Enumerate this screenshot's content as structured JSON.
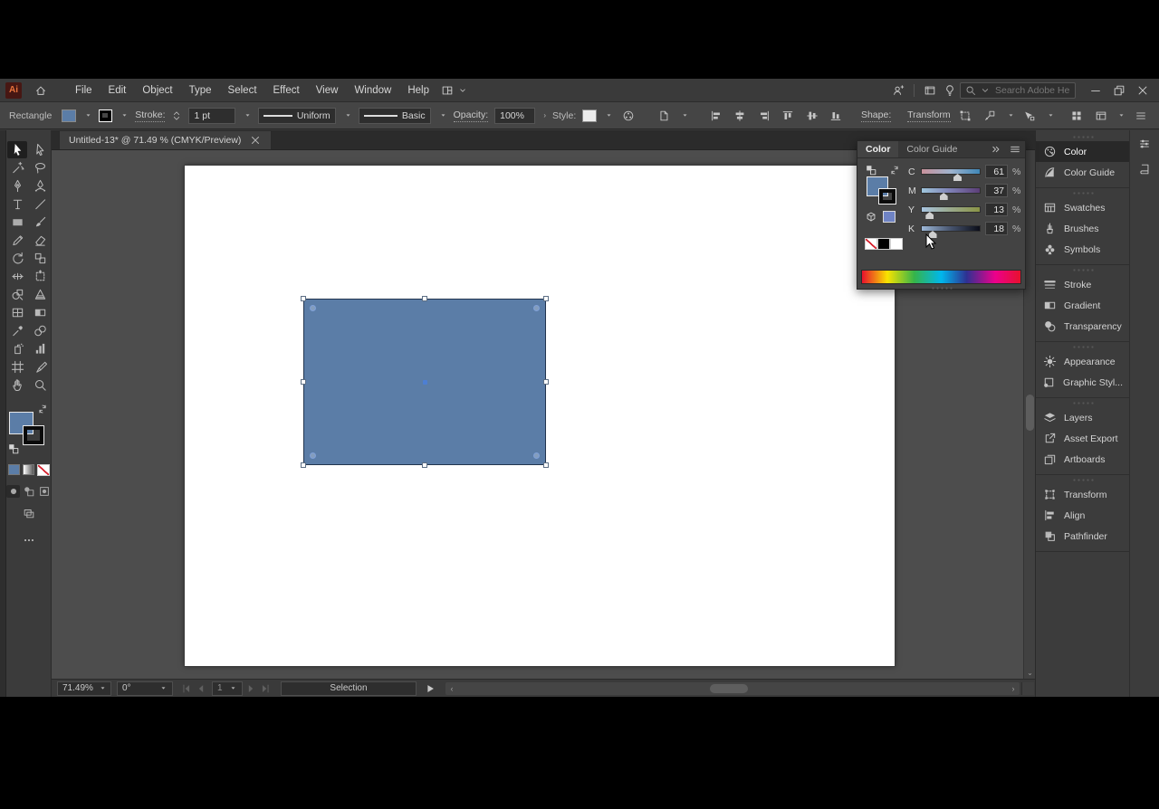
{
  "menu_bar": {
    "logo_text": "Ai",
    "menus": [
      "File",
      "Edit",
      "Object",
      "Type",
      "Select",
      "Effect",
      "View",
      "Window",
      "Help"
    ],
    "search_placeholder": "Search Adobe Help"
  },
  "control_bar": {
    "tool_context_label": "Rectangle",
    "stroke_label": "Stroke:",
    "stroke_weight_value": "1 pt",
    "variable_width_profile": "Uniform",
    "brush_definition": "Basic",
    "opacity_label": "Opacity:",
    "opacity_value": "100%",
    "style_label": "Style:",
    "shape_label": "Shape:",
    "transform_label": "Transform"
  },
  "document": {
    "tab_title": "Untitled-13* @ 71.49 % (CMYK/Preview)"
  },
  "toolbar": {
    "active_tool": "selection",
    "tools": [
      "selection",
      "direct-selection",
      "magic-wand",
      "lasso",
      "pen",
      "curvature",
      "type",
      "line-segment",
      "rectangle",
      "paintbrush",
      "shaper",
      "eraser",
      "rotate",
      "scale",
      "width",
      "free-transform",
      "shape-builder",
      "perspective-grid",
      "mesh",
      "gradient",
      "eyedropper",
      "blend",
      "symbol-sprayer",
      "column-graph",
      "artboard",
      "slice",
      "hand",
      "zoom"
    ]
  },
  "color_panel": {
    "tabs": [
      {
        "label": "Color",
        "active": true
      },
      {
        "label": "Color Guide",
        "active": false
      }
    ],
    "unit": "%",
    "channels": [
      {
        "label": "C",
        "value": "61",
        "percent": 61,
        "gradient": "linear-gradient(to right,#c9919b,#9fb3cd,#3f87b8)"
      },
      {
        "label": "M",
        "value": "37",
        "percent": 37,
        "gradient": "linear-gradient(to right,#9fc6dc,#7e7fb4,#5c3e78)"
      },
      {
        "label": "Y",
        "value": "13",
        "percent": 13,
        "gradient": "linear-gradient(to right,#a8c4e0,#9aa98c,#8a9446)"
      },
      {
        "label": "K",
        "value": "18",
        "percent": 18,
        "gradient": "linear-gradient(to right,#9db8d8,#47546e,#0b0d18)"
      }
    ],
    "fill_color": "#5b7da7"
  },
  "right_dock": {
    "groups": [
      [
        {
          "label": "Color",
          "icon": "color-panel-icon",
          "active": true
        },
        {
          "label": "Color Guide",
          "icon": "color-guide-icon",
          "active": false
        }
      ],
      [
        {
          "label": "Swatches",
          "icon": "swatches-icon",
          "active": false
        },
        {
          "label": "Brushes",
          "icon": "brushes-icon",
          "active": false
        },
        {
          "label": "Symbols",
          "icon": "symbols-icon",
          "active": false
        }
      ],
      [
        {
          "label": "Stroke",
          "icon": "stroke-icon",
          "active": false
        },
        {
          "label": "Gradient",
          "icon": "gradient-icon",
          "active": false
        },
        {
          "label": "Transparency",
          "icon": "transparency-icon",
          "active": false
        }
      ],
      [
        {
          "label": "Appearance",
          "icon": "appearance-icon",
          "active": false
        },
        {
          "label": "Graphic Styl...",
          "icon": "graphic-styles-icon",
          "active": false
        }
      ],
      [
        {
          "label": "Layers",
          "icon": "layers-icon",
          "active": false
        },
        {
          "label": "Asset Export",
          "icon": "asset-export-icon",
          "active": false
        },
        {
          "label": "Artboards",
          "icon": "artboards-icon",
          "active": false
        }
      ],
      [
        {
          "label": "Transform",
          "icon": "transform-icon",
          "active": false
        },
        {
          "label": "Align",
          "icon": "align-icon",
          "active": false
        },
        {
          "label": "Pathfinder",
          "icon": "pathfinder-icon",
          "active": false
        }
      ]
    ]
  },
  "status_bar": {
    "zoom_value": "71.49%",
    "rotation_value": "0°",
    "artboard_number": "1",
    "status_text": "Selection"
  },
  "canvas": {
    "rect_fill": "#5b7da7"
  }
}
